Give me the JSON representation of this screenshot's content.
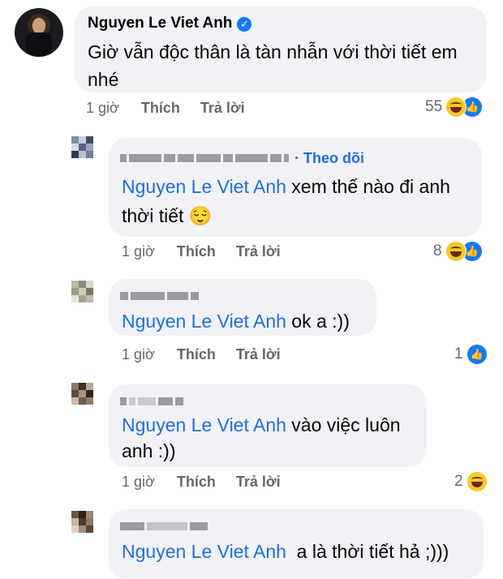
{
  "comment": {
    "author": "Nguyen Le Viet Anh",
    "text_line1": "Giờ vẫn độc thân là tàn nhẫn với thời tiết em",
    "text_line2": "nhé",
    "time": "1 giờ",
    "like_label": "Thích",
    "reply_label": "Trả lời",
    "reaction_count": "55",
    "reaction_icons": [
      "haha-icon",
      "like-icon"
    ],
    "verified_icon": "verified-check-icon"
  },
  "replies": [
    {
      "follow_label": "· Theo dõi",
      "mention": "Nguyen Le Viet Anh",
      "text_line1": " xem thế nào đi anh",
      "text_line2": "thời tiết 😌",
      "time": "1 giờ",
      "like_label": "Thích",
      "reply_label": "Trả lời",
      "reaction_count": "8",
      "reaction_icons": [
        "haha-icon",
        "like-icon"
      ]
    },
    {
      "mention": "Nguyen Le Viet Anh",
      "text_line1": " ok a :))",
      "time": "1 giờ",
      "like_label": "Thích",
      "reply_label": "Trả lời",
      "reaction_count": "1",
      "reaction_icons": [
        "like-icon"
      ]
    },
    {
      "mention": "Nguyen Le Viet Anh",
      "text_line1": " vào việc luôn",
      "text_line2": "anh :))",
      "time": "1 giờ",
      "like_label": "Thích",
      "reply_label": "Trả lời",
      "reaction_count": "2",
      "reaction_icons": [
        "haha-icon"
      ]
    },
    {
      "mention": "Nguyen Le Viet Anh",
      "text_line1": "  a là thời tiết hả ;)))"
    }
  ],
  "colors": {
    "bubble": "#f0f2f5",
    "mention": "#216fdb",
    "meta": "#65676b",
    "like_blue": "#1877f2",
    "haha_yellow": "#f7c928"
  }
}
